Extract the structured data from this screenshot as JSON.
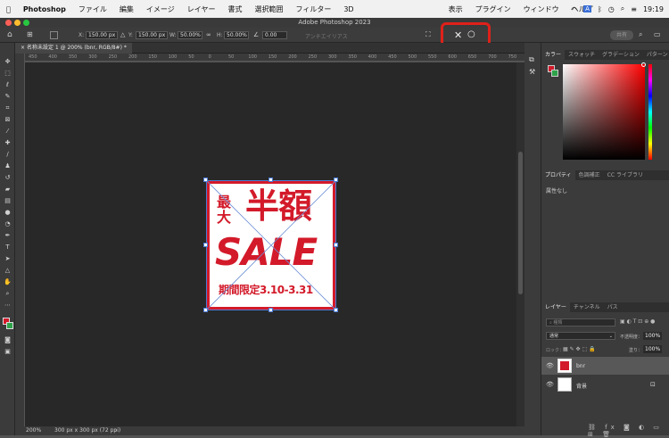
{
  "menubar": {
    "app": "Photoshop",
    "items": [
      "ファイル",
      "編集",
      "イメージ",
      "レイヤー",
      "書式",
      "選択範囲",
      "フィルター",
      "3D",
      "表示",
      "プラグイン",
      "ウィンドウ",
      "ヘルプ"
    ],
    "clock": "19:19"
  },
  "window": {
    "title": "Adobe Photoshop 2023"
  },
  "options": {
    "x_label": "X:",
    "x_value": "150.00 px",
    "y_label": "Y:",
    "y_value": "150.00 px",
    "w_label": "W:",
    "w_value": "50.00%",
    "h_label": "H:",
    "h_value": "50.00%",
    "angle_value": "0.00",
    "antialias_label": "アンチエイリアス",
    "cancel_glyph": "✕",
    "commit_glyph": "○",
    "share_label": "共有"
  },
  "document": {
    "tab_label": "名称未設定 1 @ 200% (bnr, RGB/8#) *",
    "zoom": "200%",
    "doc_info": "300 px x 300 px (72 ppi)"
  },
  "ruler": {
    "ticks": [
      "450",
      "400",
      "350",
      "300",
      "250",
      "200",
      "150",
      "100",
      "50",
      "0",
      "50",
      "100",
      "150",
      "200",
      "250",
      "300",
      "350",
      "400",
      "450",
      "500",
      "550",
      "600",
      "650",
      "700",
      "750"
    ]
  },
  "artwork": {
    "line1_small": "最大",
    "line1_big": "半額",
    "line2": "SALE",
    "line3": "期間限定3.10-3.31",
    "accent_color": "#d31a2a"
  },
  "panels": {
    "color_tabs": [
      "カラー",
      "スウォッチ",
      "グラデーション",
      "パターン"
    ],
    "props_tabs": [
      "プロパティ",
      "色調補正",
      "CC ライブラリ"
    ],
    "props_empty": "属性なし",
    "layer_tabs": [
      "レイヤー",
      "チャンネル",
      "パス"
    ],
    "search_placeholder": "種類",
    "blend_mode": "通常",
    "opacity_label": "不透明度：",
    "opacity_value": "100%",
    "lock_label": "ロック：",
    "fill_label": "塗り：",
    "fill_value": "100%",
    "layers": [
      {
        "name": "bnr"
      },
      {
        "name": "背景"
      }
    ]
  }
}
